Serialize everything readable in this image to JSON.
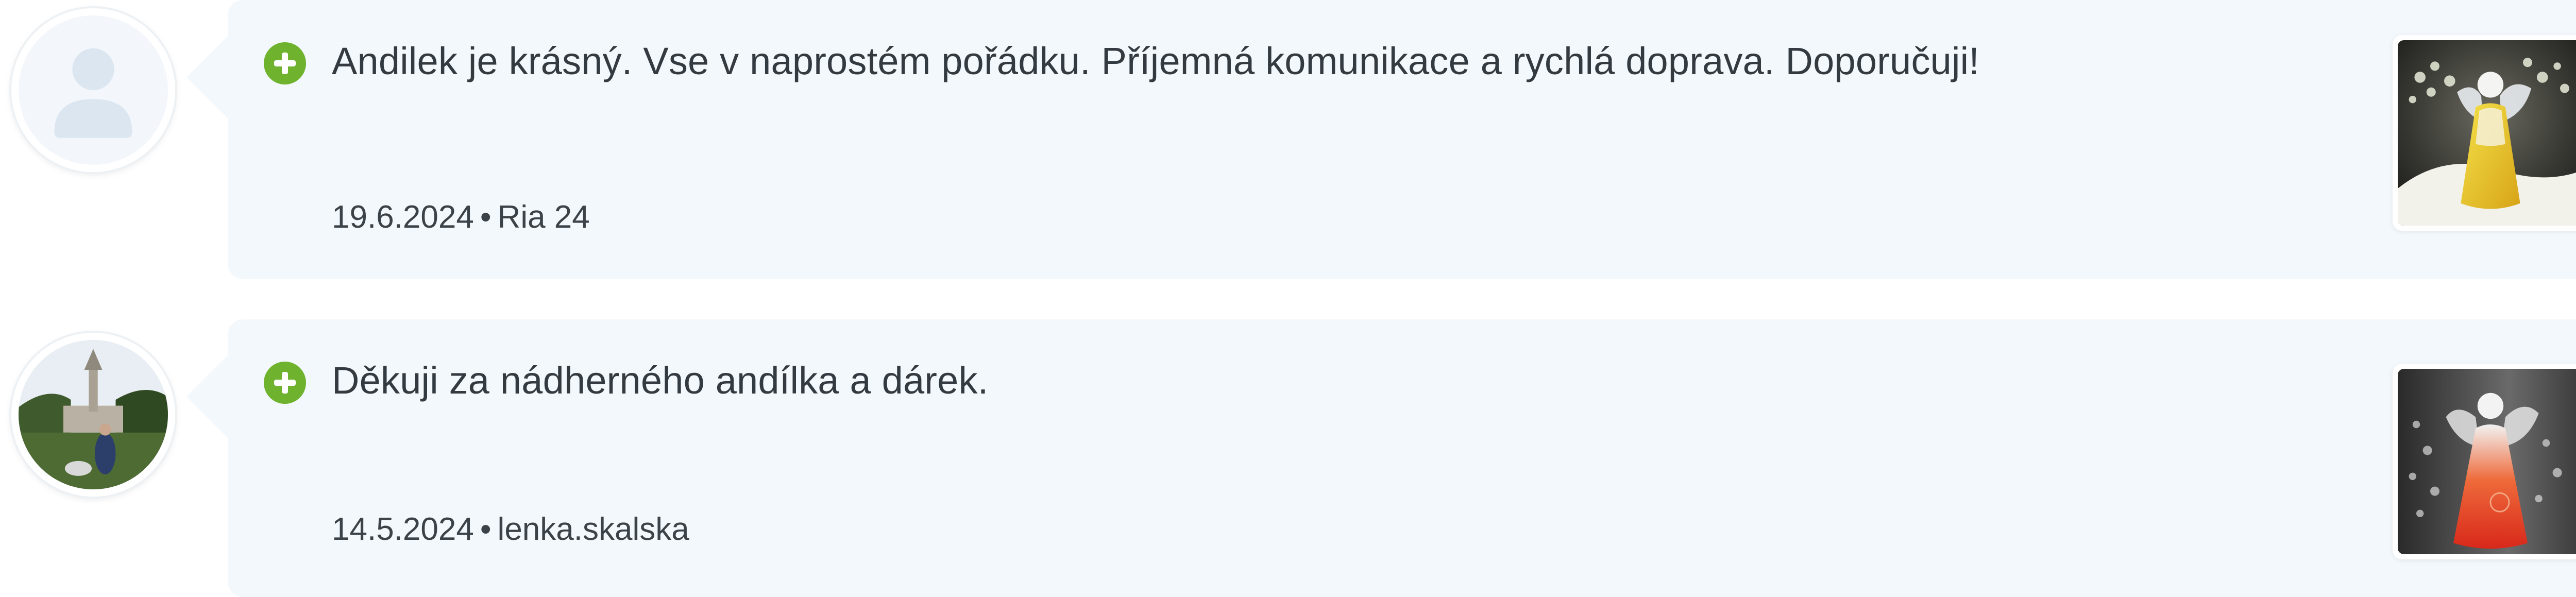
{
  "reviews": [
    {
      "icon": "plus-circle-icon",
      "text": "Andilek je krásný. Vse v naprostém pořádku. Příjemná komunikace a rychlá doprava. Doporučuji!",
      "date": "19.6.2024",
      "separator": "•",
      "author": "Ria 24",
      "avatar": "default-user-avatar",
      "photo": "angel-figurine-yellow-photo"
    },
    {
      "icon": "plus-circle-icon",
      "text": "Děkuji za nádherného andílka a dárek.",
      "date": "14.5.2024",
      "separator": "•",
      "author": "lenka.skalska",
      "avatar": "user-photo-avatar",
      "photo": "angel-figurine-red-photo"
    }
  ],
  "colors": {
    "card_background": "#f3f8fc",
    "positive_green": "#6eb22e",
    "text": "#333a40"
  }
}
